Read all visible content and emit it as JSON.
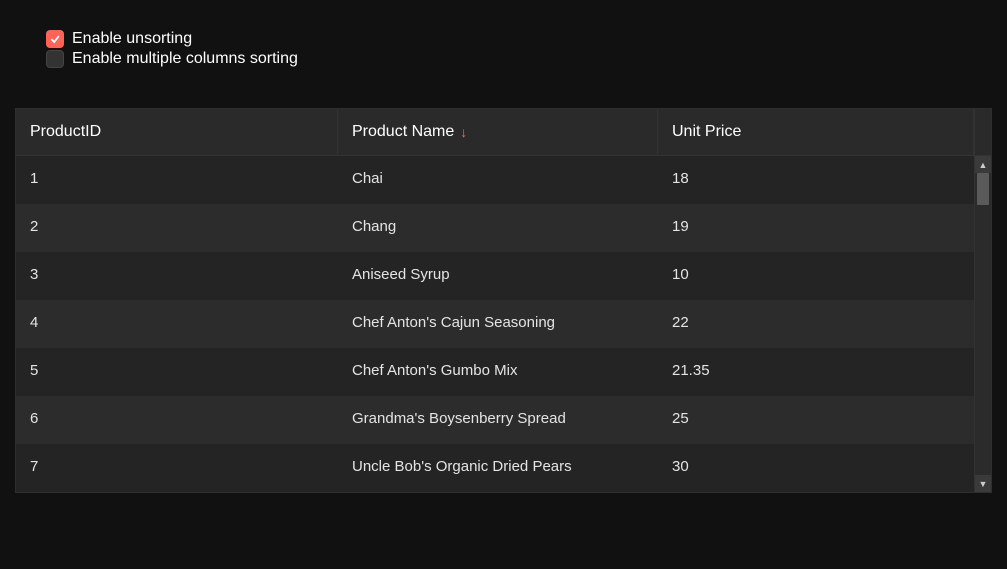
{
  "options": {
    "enable_unsorting": {
      "label": "Enable unsorting",
      "checked": true
    },
    "enable_multi_sort": {
      "label": "Enable multiple columns sorting",
      "checked": false
    }
  },
  "grid": {
    "columns": [
      {
        "label": "ProductID",
        "sort": null
      },
      {
        "label": "Product Name",
        "sort": "asc"
      },
      {
        "label": "Unit Price",
        "sort": null
      }
    ],
    "rows": [
      {
        "id": "1",
        "name": "Chai",
        "price": "18"
      },
      {
        "id": "2",
        "name": "Chang",
        "price": "19"
      },
      {
        "id": "3",
        "name": "Aniseed Syrup",
        "price": "10"
      },
      {
        "id": "4",
        "name": "Chef Anton's Cajun Seasoning",
        "price": "22"
      },
      {
        "id": "5",
        "name": "Chef Anton's Gumbo Mix",
        "price": "21.35"
      },
      {
        "id": "6",
        "name": "Grandma's Boysenberry Spread",
        "price": "25"
      },
      {
        "id": "7",
        "name": "Uncle Bob's Organic Dried Pears",
        "price": "30"
      }
    ]
  }
}
